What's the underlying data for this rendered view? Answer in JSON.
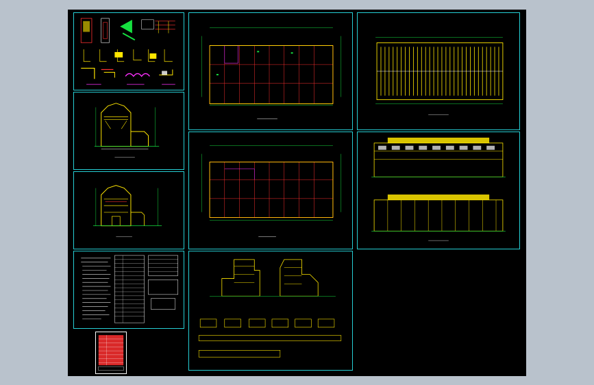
{
  "app": {
    "canvas_bg": "#000000",
    "workspace_bg": "#b9c2cc"
  },
  "colors": {
    "frame": "#26d0d6",
    "line": "#ff3030",
    "dim": "#16e040",
    "highlight": "#ffe600",
    "text": "#ffffff",
    "accent": "#ff30ff"
  },
  "sheets": [
    {
      "id": "details",
      "kind": "detail-sheet"
    },
    {
      "id": "section-1",
      "kind": "section-drawing"
    },
    {
      "id": "section-2",
      "kind": "section-drawing"
    },
    {
      "id": "notes",
      "kind": "notes-and-tables"
    },
    {
      "id": "plan-1",
      "kind": "floor-plan"
    },
    {
      "id": "plan-2",
      "kind": "floor-plan"
    },
    {
      "id": "roof-plan",
      "kind": "roof-plan"
    },
    {
      "id": "elevations",
      "kind": "long-elevations"
    },
    {
      "id": "end-elevations",
      "kind": "end-elevations"
    },
    {
      "id": "legend",
      "kind": "legend-table"
    }
  ]
}
